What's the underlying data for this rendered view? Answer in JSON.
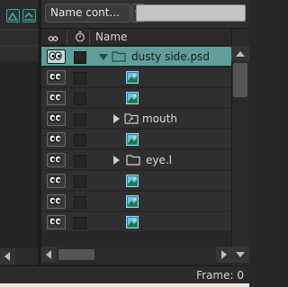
{
  "toolbar": {
    "filter_label": "Name cont...",
    "search_value": ""
  },
  "header": {
    "visibility_icon": "eye-icon",
    "lock_icon": "stopwatch-icon",
    "name_label": "Name"
  },
  "layers": [
    {
      "name": "dusty side.psd",
      "type": "folder",
      "expander": "expanded",
      "selected": true,
      "indent": 0
    },
    {
      "name": "",
      "type": "image",
      "indent": 1
    },
    {
      "name": "",
      "type": "image",
      "indent": 1
    },
    {
      "name": "mouth",
      "type": "switch-folder",
      "expander": "collapsed",
      "indent": 1
    },
    {
      "name": "",
      "type": "image",
      "indent": 1
    },
    {
      "name": "eye.l",
      "type": "folder",
      "expander": "collapsed",
      "indent": 1
    },
    {
      "name": "",
      "type": "image",
      "indent": 1
    },
    {
      "name": "",
      "type": "image",
      "indent": 1
    },
    {
      "name": "",
      "type": "image",
      "indent": 1
    }
  ],
  "status": {
    "frame_label": "Frame: 0"
  },
  "colors": {
    "selection": "#5f9e9a",
    "accent": "#4c9c98",
    "image_icon": "#3fa7c9"
  }
}
